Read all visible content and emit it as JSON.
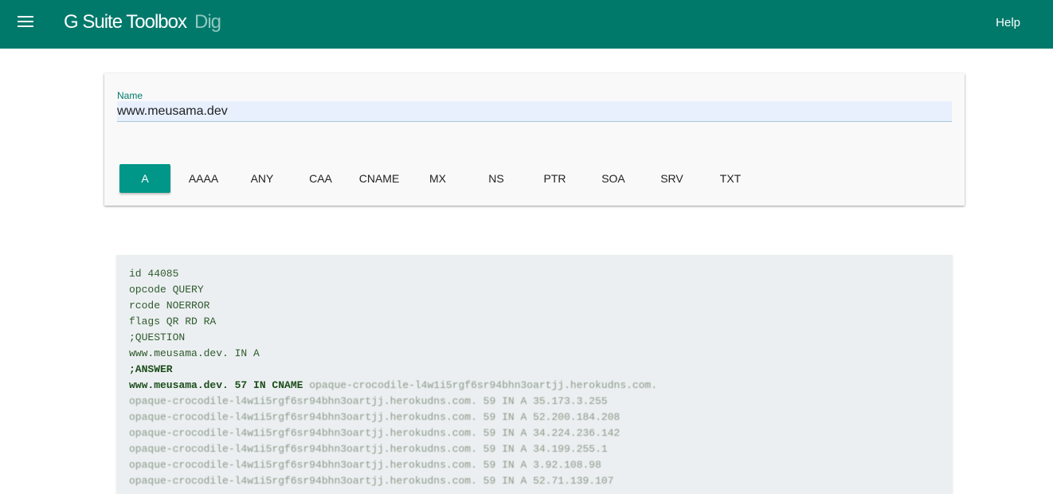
{
  "header": {
    "brand": "G Suite Toolbox",
    "tool": "Dig",
    "help_label": "Help"
  },
  "form": {
    "name_label": "Name",
    "name_value": "www.meusama.dev"
  },
  "record_types": [
    "A",
    "AAAA",
    "ANY",
    "CAA",
    "CNAME",
    "MX",
    "NS",
    "PTR",
    "SOA",
    "SRV",
    "TXT"
  ],
  "selected_type": "A",
  "result": {
    "id": "id 44085",
    "opcode": "opcode QUERY",
    "rcode": "rcode NOERROR",
    "flags": "flags QR RD RA",
    "question_header": ";QUESTION",
    "question": "www.meusama.dev. IN A",
    "answer_header": ";ANSWER",
    "answer_cname_prefix": "www.meusama.dev. 57 IN CNAME",
    "answer_cname_target": "opaque-crocodile-l4w1i5rgf6sr94bhn3oartjj.herokudns.com.",
    "answers": [
      "opaque-crocodile-l4w1i5rgf6sr94bhn3oartjj.herokudns.com. 59 IN A 35.173.3.255",
      "opaque-crocodile-l4w1i5rgf6sr94bhn3oartjj.herokudns.com. 59 IN A 52.200.184.208",
      "opaque-crocodile-l4w1i5rgf6sr94bhn3oartjj.herokudns.com. 59 IN A 34.224.236.142",
      "opaque-crocodile-l4w1i5rgf6sr94bhn3oartjj.herokudns.com. 59 IN A 34.199.255.1",
      "opaque-crocodile-l4w1i5rgf6sr94bhn3oartjj.herokudns.com. 59 IN A 3.92.108.98",
      "opaque-crocodile-l4w1i5rgf6sr94bhn3oartjj.herokudns.com. 59 IN A 52.71.139.107"
    ]
  },
  "colors": {
    "header_bg": "#00796b",
    "accent": "#009688"
  }
}
